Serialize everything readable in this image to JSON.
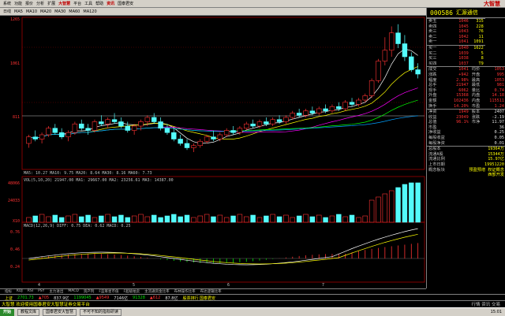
{
  "menu": {
    "items": [
      "系统",
      "功能",
      "报价",
      "分析",
      "扩展",
      "大智慧",
      "平台",
      "工具",
      "帮助",
      "资讯",
      "国泰君安"
    ],
    "brand": "大智慧"
  },
  "toolbar": {
    "items": [
      "日线",
      "MA5",
      "MA10",
      "MA20",
      "MA30",
      "MA60",
      "MA120"
    ],
    "logo": "大智慧"
  },
  "stock": {
    "code": "000586",
    "name": "汇源通信"
  },
  "price_panel": {
    "top_values": [
      "1265"
    ],
    "sell": [
      {
        "label": "卖五",
        "price": "1046",
        "vol": "315"
      },
      {
        "label": "卖四",
        "price": "1045",
        "vol": "228"
      },
      {
        "label": "卖三",
        "price": "1043",
        "vol": "76"
      },
      {
        "label": "卖二",
        "price": "1042",
        "vol": "11"
      },
      {
        "label": "卖一",
        "price": "1041",
        "vol": "1091"
      }
    ],
    "buy": [
      {
        "label": "买一",
        "price": "1040",
        "vol": "1622"
      },
      {
        "label": "买二",
        "price": "1039",
        "vol": "5"
      },
      {
        "label": "买三",
        "price": "1038",
        "vol": "8"
      },
      {
        "label": "买四",
        "price": "1037",
        "vol": "T9"
      }
    ],
    "stats": [
      {
        "l1": "成交",
        "v1": "1041",
        "l2": "均价",
        "v2": "1053"
      },
      {
        "l1": "涨跌",
        "v1": "+942",
        "l2": "开盘",
        "v2": "995"
      },
      {
        "l1": "幅度",
        "v1": "2.98%",
        "l2": "最高",
        "v2": "1053"
      },
      {
        "l1": "总手",
        "v1": "21947",
        "l2": "最低",
        "v2": "981"
      },
      {
        "l1": "现手",
        "v1": "6062",
        "l2": "量比",
        "v2": "0.74"
      },
      {
        "l1": "外盘",
        "v1": "15368",
        "l2": "内盘",
        "v2": "14.18"
      },
      {
        "l1": "金额",
        "v1": "102436",
        "l2": "内盘",
        "v2": "115511"
      },
      {
        "l1": "换手",
        "v1": "14.20%",
        "l2": "市盈",
        "v2": "1.24"
      }
    ],
    "stats2": [
      {
        "l1": "净资",
        "v1": "1949",
        "l2": "股本",
        "v2": "2407"
      },
      {
        "l1": "收益",
        "v1": "23049",
        "l2": "涨跌",
        "v2": "-2.19"
      },
      {
        "l1": "总值",
        "v1": "96.1%",
        "l2": "市净",
        "v2": "11.97"
      },
      {
        "l1": "市盈",
        "v1": "",
        "l2": "",
        "v2": "36"
      },
      {
        "l1": "净收益",
        "v1": "",
        "l2": "",
        "v2": "0.25"
      },
      {
        "l1": "每股收益",
        "v1": "",
        "l2": "",
        "v2": "0.05"
      },
      {
        "l1": "每股净资",
        "v1": "",
        "l2": "",
        "v2": "0.01"
      }
    ],
    "info": [
      {
        "l": "总股本",
        "v": "19364万"
      },
      {
        "l": "流通A股",
        "v": "15344万"
      },
      {
        "l": "流通比例",
        "v": "15.97亿"
      },
      {
        "l": "上市日期",
        "v": "19951220"
      },
      {
        "l": "概念板块",
        "v": "预盈预增 权证概念"
      },
      {
        "l": "",
        "v": "西部开发"
      }
    ]
  },
  "chart_labels": {
    "price_axis": [
      "1265",
      "1061",
      "811"
    ],
    "ma_legend": "MA5: 10.27  MA10: 9.75  MA20: 8.64  MA30: 8.16  MA60: 7.73",
    "vol_legend": "VOL(5,10,20)  21947.00  MA1: 29667.00  MA2: 23256.61  MA3: 14387.00",
    "vol_axis": [
      "48066",
      "24033",
      "X10"
    ],
    "macd_legend": "MACD(12,26,9)  DIFF: 0.75  DEA: 0.62  MACD: 0.25",
    "macd_axis": [
      "0.76",
      "0.46",
      "0.24"
    ],
    "date_marks": [
      "4",
      "5",
      "6",
      "7"
    ]
  },
  "tabs": [
    "指标",
    "KDJ",
    "RSI",
    "PSY",
    "主力进出",
    "MACD",
    "资产列",
    "F蓝筹星币值",
    "F超级拍卖",
    "主流通资金比率",
    "布林操作比率",
    "布达逻辑比率"
  ],
  "status1": {
    "index_label": "上证",
    "index_value": "2701.73",
    "up": "▲705",
    "amount": "837.9亿",
    "change": "1199045",
    "shen": "▲9549",
    "amount2": "7146亿",
    "sh_index": "91328",
    "sz": "▲612",
    "pct": "87.8亿",
    "news": "股票排行 国泰君安"
  },
  "status2": {
    "text": "大智慧 欢迎使用国泰君安大智慧证券交易平台",
    "right": "行情 资讯 交易"
  },
  "taskbar": {
    "start": "开始",
    "tasks": [
      "教程文库",
      "国泰君安大智慧",
      "不可不知的指标研读"
    ],
    "clock": "15:01"
  },
  "chart_data": {
    "type": "candlestick",
    "candles": [
      [
        7.2,
        7.6,
        7.0,
        7.5
      ],
      [
        7.5,
        7.8,
        7.3,
        7.4
      ],
      [
        7.4,
        7.7,
        7.2,
        7.6
      ],
      [
        7.6,
        8.0,
        7.5,
        7.9
      ],
      [
        7.9,
        8.1,
        7.6,
        7.7
      ],
      [
        7.7,
        7.9,
        7.4,
        7.5
      ],
      [
        7.5,
        7.8,
        7.3,
        7.7
      ],
      [
        7.7,
        8.2,
        7.6,
        8.1
      ],
      [
        8.1,
        8.3,
        7.8,
        7.9
      ],
      [
        7.9,
        8.1,
        7.6,
        7.8
      ],
      [
        7.8,
        8.3,
        7.7,
        8.2
      ],
      [
        8.2,
        8.5,
        8.0,
        8.1
      ],
      [
        8.1,
        8.4,
        7.9,
        8.3
      ],
      [
        8.3,
        8.6,
        8.1,
        8.2
      ],
      [
        8.2,
        8.4,
        7.9,
        8.0
      ],
      [
        8.0,
        8.2,
        7.7,
        7.8
      ],
      [
        7.8,
        8.1,
        7.6,
        8.0
      ],
      [
        8.0,
        8.3,
        7.8,
        8.2
      ],
      [
        8.2,
        8.5,
        8.0,
        8.4
      ],
      [
        8.4,
        8.6,
        8.1,
        8.2
      ],
      [
        8.2,
        8.4,
        7.8,
        7.9
      ],
      [
        7.9,
        8.1,
        7.6,
        7.7
      ],
      [
        7.7,
        7.9,
        7.3,
        7.4
      ],
      [
        7.4,
        7.6,
        7.1,
        7.2
      ],
      [
        7.2,
        7.4,
        6.9,
        7.0
      ],
      [
        7.0,
        7.2,
        6.8,
        7.1
      ],
      [
        7.1,
        7.4,
        7.0,
        7.3
      ],
      [
        7.3,
        7.6,
        7.2,
        7.5
      ],
      [
        7.5,
        7.8,
        7.3,
        7.4
      ],
      [
        7.4,
        7.7,
        7.3,
        7.6
      ],
      [
        7.6,
        7.9,
        7.5,
        7.8
      ],
      [
        7.8,
        8.0,
        7.6,
        7.7
      ],
      [
        7.7,
        8.0,
        7.6,
        7.9
      ],
      [
        7.9,
        8.2,
        7.8,
        8.1
      ],
      [
        8.1,
        8.3,
        7.9,
        8.0
      ],
      [
        8.0,
        8.3,
        7.9,
        8.2
      ],
      [
        8.2,
        8.4,
        8.0,
        8.1
      ],
      [
        8.1,
        8.4,
        8.0,
        8.3
      ],
      [
        8.3,
        8.5,
        8.1,
        8.2
      ],
      [
        8.2,
        8.5,
        8.1,
        8.4
      ],
      [
        8.4,
        8.7,
        8.3,
        8.6
      ],
      [
        8.6,
        8.8,
        8.4,
        8.5
      ],
      [
        8.5,
        8.8,
        8.4,
        8.7
      ],
      [
        8.7,
        8.9,
        8.5,
        8.6
      ],
      [
        8.6,
        8.9,
        8.5,
        8.8
      ],
      [
        8.8,
        9.0,
        8.6,
        8.7
      ],
      [
        8.7,
        9.0,
        8.6,
        8.9
      ],
      [
        8.9,
        9.1,
        8.7,
        8.8
      ],
      [
        8.8,
        9.2,
        8.7,
        9.1
      ],
      [
        9.1,
        9.3,
        8.9,
        9.0
      ],
      [
        9.0,
        9.3,
        8.9,
        9.2
      ],
      [
        9.2,
        9.5,
        9.1,
        9.4
      ],
      [
        9.4,
        10.2,
        9.3,
        10.1
      ],
      [
        10.1,
        11.1,
        10.0,
        11.0
      ],
      [
        11.0,
        12.1,
        10.8,
        11.5
      ],
      [
        11.5,
        12.6,
        11.2,
        12.3
      ],
      [
        12.3,
        12.7,
        11.6,
        11.8
      ],
      [
        11.8,
        12.2,
        11.0,
        11.2
      ],
      [
        11.2,
        11.4,
        10.5,
        10.6
      ],
      [
        10.6,
        10.9,
        10.2,
        10.4
      ]
    ],
    "ylim": [
      6.0,
      12.8
    ]
  }
}
